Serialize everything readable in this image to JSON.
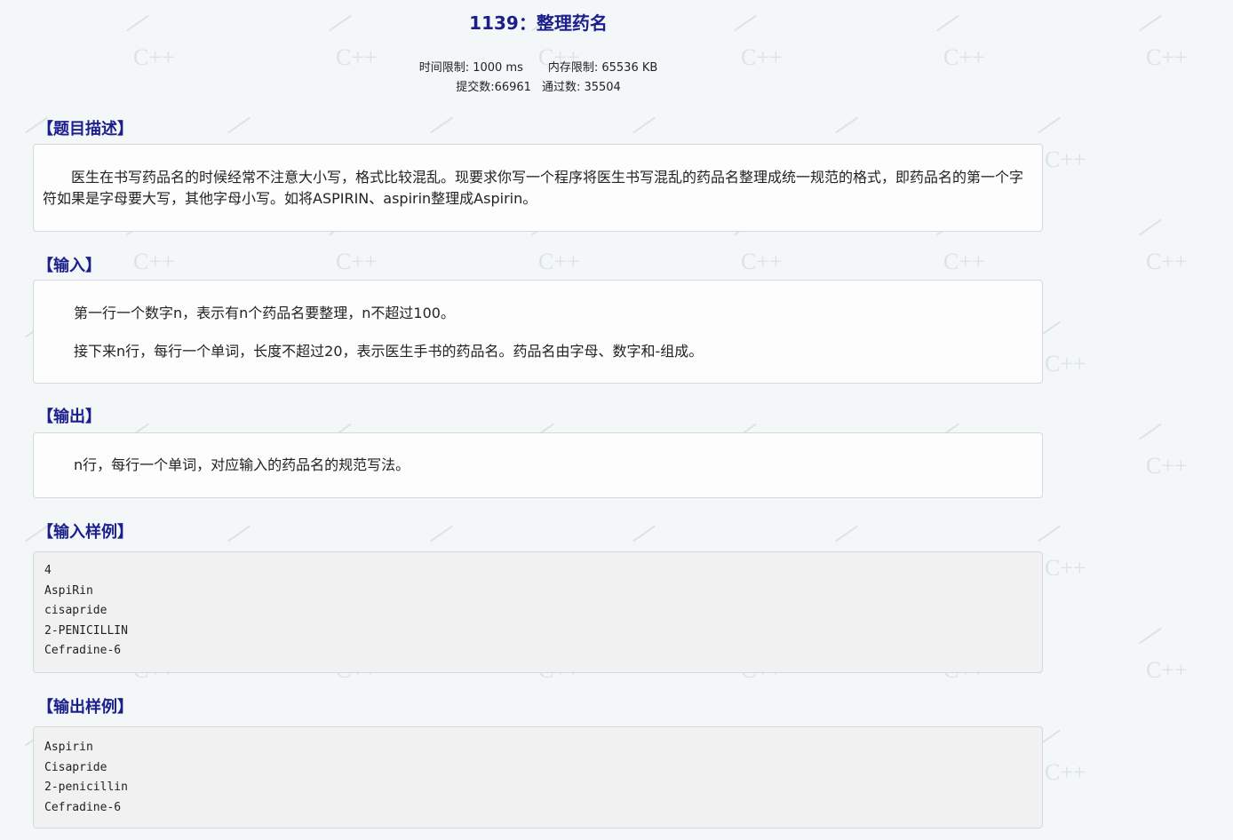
{
  "problem": {
    "title": "1139：整理药名",
    "time_limit": "时间限制: 1000 ms",
    "memory_limit": "内存限制: 65536 KB",
    "submissions": "提交数:66961",
    "accepted": "通过数: 35504"
  },
  "sections": {
    "description": {
      "heading": "【题目描述】",
      "text": "医生在书写药品名的时候经常不注意大小写，格式比较混乱。现要求你写一个程序将医生书写混乱的药品名整理成统一规范的格式，即药品名的第一个字符如果是字母要大写，其他字母小写。如将ASPIRIN、aspirin整理成Aspirin。"
    },
    "input": {
      "heading": "【输入】",
      "line1": "第一行一个数字n，表示有n个药品名要整理，n不超过100。",
      "line2": "接下来n行，每行一个单词，长度不超过20，表示医生手书的药品名。药品名由字母、数字和-组成。"
    },
    "output": {
      "heading": "【输出】",
      "text": "n行，每行一个单词，对应输入的药品名的规范写法。"
    },
    "sample_input": {
      "heading": "【输入样例】",
      "lines": [
        "4",
        "AspiRin",
        "cisapride",
        "2-PENICILLIN",
        "Cefradine-6"
      ]
    },
    "sample_output": {
      "heading": "【输出样例】",
      "lines": [
        "Aspirin",
        "Cisapride",
        "2-penicillin",
        "Cefradine-6"
      ]
    }
  },
  "watermark": {
    "text": "C++"
  }
}
